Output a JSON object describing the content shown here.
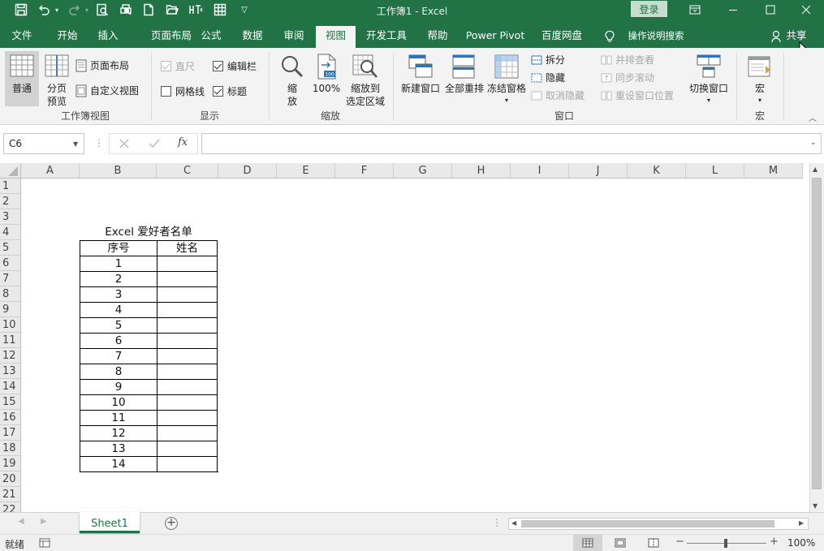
{
  "app": {
    "title": "工作簿1  -  Excel",
    "login": "登录"
  },
  "colors": {
    "brand": "#217346",
    "ribbon_bg": "#f3f3f3",
    "grid_line": "#d4d4d4"
  },
  "quick_access": {
    "icons": [
      "save-icon",
      "undo-icon",
      "redo-icon",
      "print-preview-icon",
      "quick-print-icon",
      "new-file-icon",
      "open-folder-icon",
      "touch-mode-icon",
      "table-icon",
      "customize-toolbar-icon"
    ]
  },
  "tabs": [
    {
      "label": "文件"
    },
    {
      "label": "开始"
    },
    {
      "label": "插入"
    },
    {
      "label": "页面布局"
    },
    {
      "label": "公式"
    },
    {
      "label": "数据"
    },
    {
      "label": "审阅"
    },
    {
      "label": "视图"
    },
    {
      "label": "开发工具"
    },
    {
      "label": "帮助"
    },
    {
      "label": "Power Pivot"
    },
    {
      "label": "百度网盘"
    }
  ],
  "tell_me": "操作说明搜索",
  "share": "共享",
  "ribbon": {
    "workbook_views": {
      "label": "工作簿视图",
      "normal": "普通",
      "page_break_1": "分页",
      "page_break_2": "预览",
      "page_layout": "页面布局",
      "custom_views": "自定义视图"
    },
    "show": {
      "label": "显示",
      "ruler": "直尺",
      "formula_bar": "编辑栏",
      "gridlines": "网格线",
      "headings": "标题"
    },
    "zoom": {
      "label": "缩放",
      "zoom_1": "缩",
      "zoom_2": "放",
      "hundred": "100%",
      "zoom_sel_1": "缩放到",
      "zoom_sel_2": "选定区域"
    },
    "window": {
      "label": "窗口",
      "new_window": "新建窗口",
      "arrange_all": "全部重排",
      "freeze_panes": "冻结窗格",
      "split": "拆分",
      "hide": "隐藏",
      "unhide": "取消隐藏",
      "side_by_side": "并排查看",
      "sync_scroll": "同步滚动",
      "reset_position": "重设窗口位置",
      "switch_windows": "切换窗口"
    },
    "macros": {
      "label": "宏",
      "macros": "宏"
    }
  },
  "formula_bar": {
    "name_box": "C6",
    "fx": "fx",
    "value": ""
  },
  "sheet": {
    "columns": [
      "A",
      "B",
      "C",
      "D",
      "E",
      "F",
      "G",
      "H",
      "I",
      "J",
      "K",
      "L",
      "M"
    ],
    "rows": [
      "1",
      "2",
      "3",
      "4",
      "5",
      "6",
      "7",
      "8",
      "9",
      "10",
      "11",
      "12",
      "13",
      "14",
      "15",
      "16",
      "17",
      "18",
      "19",
      "20",
      "21",
      "22"
    ],
    "table_title": "Excel 爱好者名单",
    "headers": {
      "seq": "序号",
      "name": "姓名"
    },
    "seq_values": [
      "1",
      "2",
      "3",
      "4",
      "5",
      "6",
      "7",
      "8",
      "9",
      "10",
      "11",
      "12",
      "13",
      "14"
    ]
  },
  "sheet_tabs": [
    {
      "label": "Sheet1",
      "active": true
    }
  ],
  "status": {
    "ready": "就绪",
    "zoom": "100%"
  }
}
